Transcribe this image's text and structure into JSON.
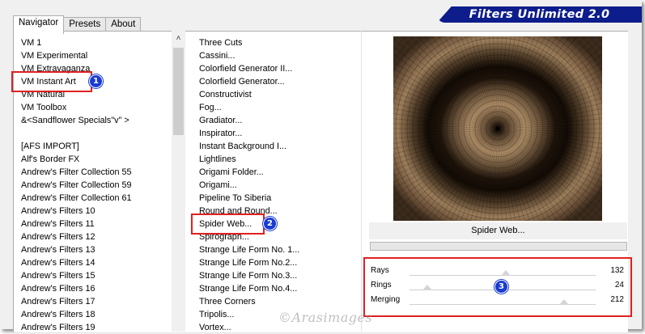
{
  "app": {
    "title": "Filters Unlimited 2.0"
  },
  "tabs": [
    {
      "label": "Navigator"
    },
    {
      "label": "Presets"
    },
    {
      "label": "About"
    }
  ],
  "categories": [
    "VM 1",
    "VM Experimental",
    "VM Extravaganza",
    "VM Instant Art",
    "VM Natural",
    "VM Toolbox",
    "&<Sandflower Specials\"v\" >",
    "",
    "[AFS IMPORT]",
    "Alf's Border FX",
    "Andrew's Filter Collection 55",
    "Andrew's Filter Collection 59",
    "Andrew's Filter Collection 61",
    "Andrew's Filters 10",
    "Andrew's Filters 11",
    "Andrew's Filters 12",
    "Andrew's Filters 13",
    "Andrew's Filters 14",
    "Andrew's Filters 15",
    "Andrew's Filters 16",
    "Andrew's Filters 17",
    "Andrew's Filters 18",
    "Andrew's Filters 19"
  ],
  "filters": [
    "Three Cuts",
    "Cassini...",
    "Colorfield Generator II...",
    "Colorfield Generator...",
    "Constructivist",
    "Fog...",
    "Gradiator...",
    "Inspirator...",
    "Instant Background I...",
    "Lightlines",
    "Origami Folder...",
    "Origami...",
    "Pipeline To Siberia",
    "Round and Round...",
    "Spider Web...",
    "Spirograph...",
    "Strange Life Form No. 1...",
    "Strange Life Form No.2...",
    "Strange Life Form No.3...",
    "Strange Life Form No.4...",
    "Three Corners",
    "Tripolis...",
    "Vortex..."
  ],
  "selected_category": "VM Instant Art",
  "selected_filter": "Spider Web...",
  "preview": {
    "filter_name": "Spider Web..."
  },
  "params": [
    {
      "label": "Rays",
      "value": "132",
      "fraction": 0.518
    },
    {
      "label": "Rings",
      "value": "24",
      "fraction": 0.094
    },
    {
      "label": "Merging",
      "value": "212",
      "fraction": 0.831
    }
  ],
  "annotations": {
    "n1": "1",
    "n2": "2",
    "n3": "3"
  },
  "watermark": "©Arasimages",
  "colors": {
    "banner": "#0d1d8c",
    "highlight": "#e02020",
    "marker": "#1a3bd1"
  }
}
